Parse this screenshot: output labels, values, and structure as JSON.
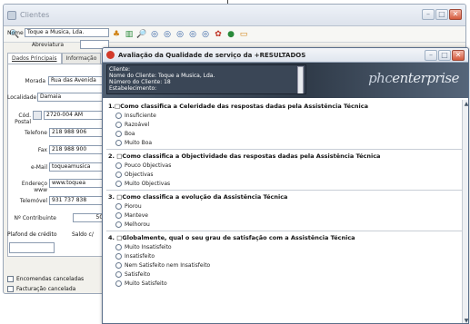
{
  "bg_window": {
    "title": "Clientes",
    "tabs": [
      "Dados Principais",
      "Informação"
    ],
    "fields": [
      {
        "label": "Nome",
        "value": "Toque a Musica, Lda."
      },
      {
        "label": "Abreviatura",
        "value": ""
      },
      {
        "label": "Morada",
        "value": "Rua das Avenida"
      },
      {
        "label": "Localidade",
        "value": "Damaia"
      },
      {
        "label": "Cód. Postal",
        "value": "2720-004 AM"
      },
      {
        "label": "Telefone",
        "value": "218 988 906"
      },
      {
        "label": "Fax",
        "value": "218 988 900"
      },
      {
        "label": "e-Mail",
        "value": "toqueamusica"
      },
      {
        "label": "Endereço www",
        "value": "www.toquea"
      },
      {
        "label": "Telemóvel",
        "value": "931 737 838"
      },
      {
        "label": "Nº Contribuinte",
        "value": "502"
      }
    ],
    "plafond_label": "Plafond de crédito",
    "saldo_label": "Saldo c/",
    "checkboxes": [
      "Encomendas canceladas",
      "Facturação cancelada"
    ]
  },
  "dialog": {
    "title": "Avaliação da Qualidade de serviço da +RESULTADOS",
    "header_lines": [
      "Cliente:",
      "Nome do Cliente: Toque a Musica, Lda.",
      "Número do Cliente:        18",
      "Estabelecimento:"
    ],
    "brand_prefix": "phc",
    "brand_main": "enterprise",
    "questions": [
      {
        "title": "1.□Como classifica a Celeridade das respostas dadas pela Assistência Técnica",
        "options": [
          "Insuficiente",
          "Razoável",
          "Boa",
          "Muito Boa"
        ]
      },
      {
        "title": "2. □Como classifica a Objectividade das respostas dadas pela Assistência Técnica",
        "options": [
          "Pouco Objectivas",
          "Objectivas",
          "Muito Objectivas"
        ]
      },
      {
        "title": "3. □Como classifica a evolução da Assistência Técnica",
        "options": [
          "Piorou",
          "Manteve",
          "Melhorou"
        ]
      },
      {
        "title": "4. □Globalmente, qual o seu grau de satisfação com a Assistência Técnica",
        "options": [
          "Muito Insatisfeito",
          "Insatisfeito",
          "Nem Satisfeito nem Insatisfeito",
          "Satisfeito",
          "Muito Satisfeito"
        ]
      }
    ]
  }
}
